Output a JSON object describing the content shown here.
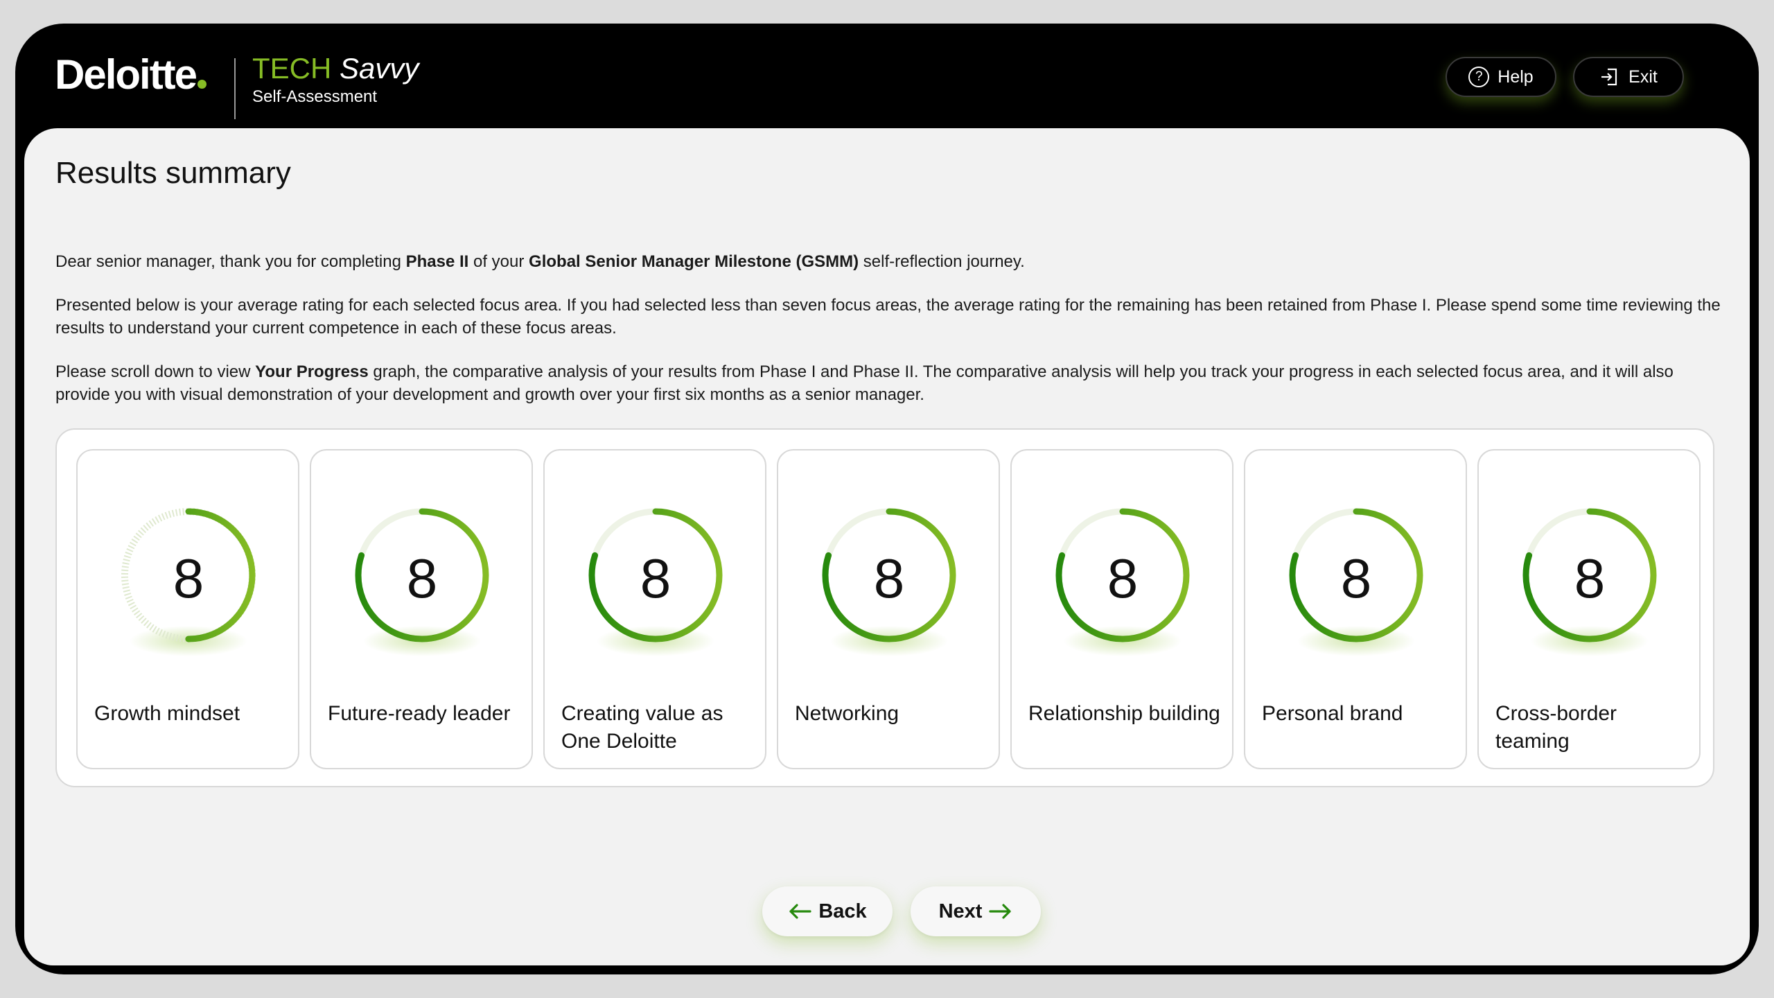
{
  "header": {
    "logo_text": "Deloitte",
    "brand_tech": "TECH",
    "brand_savvy": "Savvy",
    "brand_sub": "Self-Assessment",
    "help_label": "Help",
    "exit_label": "Exit"
  },
  "main": {
    "title": "Results summary",
    "p1": {
      "a": "Dear senior manager, thank you for completing ",
      "b": "Phase II",
      "c": " of your ",
      "d": "Global Senior Manager Milestone (GSMM)",
      "e": " self-reflection journey."
    },
    "p2": "Presented below is your average rating for each selected focus area. If you had selected less than seven focus areas, the average rating for the remaining has been retained from Phase I. Please spend some time reviewing the results to understand your current competence in each of these focus areas.",
    "p3": {
      "a": "Please scroll down to view ",
      "b": "Your Progress",
      "c": " graph, the comparative analysis of your results from Phase I and Phase II. The comparative analysis will help you track your progress in each selected focus area, and it will also provide you with visual demonstration of your development and growth over your first six months as a senior manager."
    }
  },
  "cards": [
    {
      "label": "Growth mindset",
      "score": "8",
      "fraction": 0.5
    },
    {
      "label": "Future-ready leader",
      "score": "8",
      "fraction": 0.8
    },
    {
      "label": "Creating value as One Deloitte",
      "score": "8",
      "fraction": 0.8
    },
    {
      "label": "Networking",
      "score": "8",
      "fraction": 0.8
    },
    {
      "label": "Relationship building",
      "score": "8",
      "fraction": 0.8
    },
    {
      "label": "Personal brand",
      "score": "8",
      "fraction": 0.8
    },
    {
      "label": "Cross-border teaming",
      "score": "8",
      "fraction": 0.8
    }
  ],
  "nav": {
    "back_label": "Back",
    "next_label": "Next"
  },
  "colors": {
    "accent": "#86bc25",
    "accent_dark": "#26890d",
    "track": "#eef3e6"
  }
}
